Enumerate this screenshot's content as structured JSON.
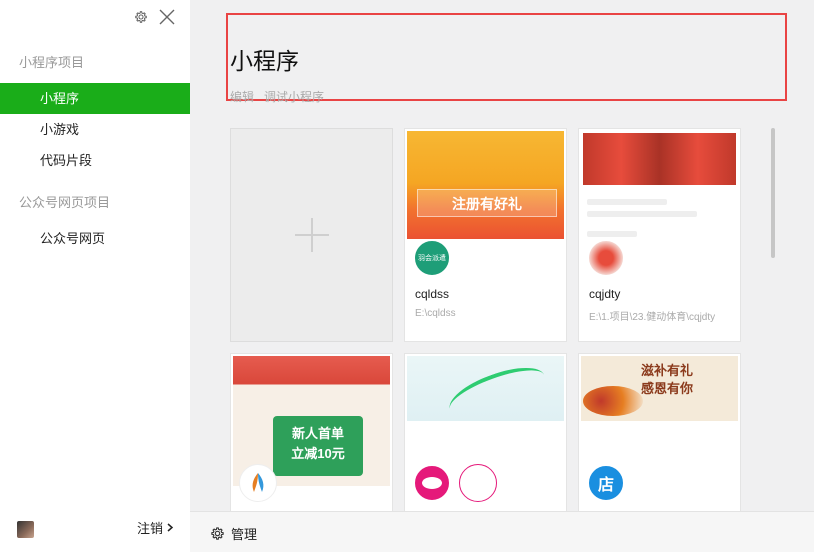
{
  "sidebar": {
    "section_miniprogram": "小程序项目",
    "items_miniprogram": [
      "小程序",
      "小游戏",
      "代码片段"
    ],
    "section_web": "公众号网页项目",
    "items_web": [
      "公众号网页"
    ],
    "logout_label": "注销"
  },
  "main": {
    "title": "小程序",
    "links": [
      "编辑",
      "调试小程序"
    ]
  },
  "cards": [
    {
      "name": "cqldss",
      "path": "E:\\cqldss"
    },
    {
      "name": "cqjdty",
      "path": "E:\\1.项目\\23.健动体育\\cqjdty"
    }
  ],
  "thumb_text": {
    "card1_banner": "注册有好礼",
    "card1_icon": "羽会派遣",
    "card3_coupon": "新人首单\n立减10元",
    "card5_title": "滋补有礼\n感恩有你",
    "card5_icon": "店"
  },
  "bottom_bar": {
    "manage_label": "管理"
  },
  "colors": {
    "active_green": "#1aad19",
    "highlight_red": "#e94444"
  }
}
